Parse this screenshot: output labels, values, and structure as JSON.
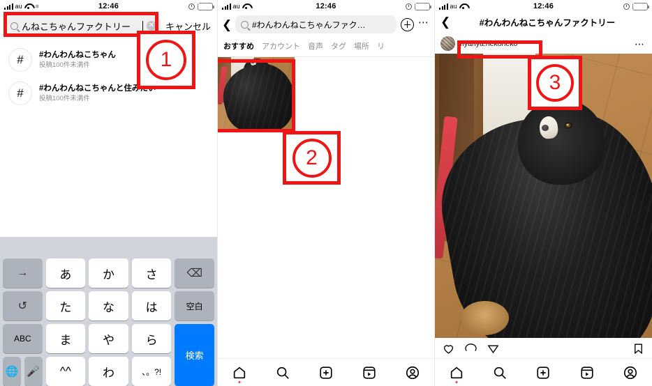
{
  "status_bar": {
    "carrier": "au",
    "time": "12:46",
    "signal_icon": "signal-bars-icon",
    "wifi_icon": "wifi-icon",
    "weather_icon": "snowflake-icon",
    "alarm_icon": "alarm-clock-icon",
    "battery_icon": "battery-charging-icon",
    "battery_color": "#3ad24a"
  },
  "panel1": {
    "search": {
      "value": "んねこちゃんファクトリー",
      "icon": "search-icon",
      "clear_icon": "clear-circle-icon",
      "cancel_label": "キャンセル"
    },
    "results": [
      {
        "icon": "hashtag-icon",
        "title": "#わんわんねこちゃん",
        "subtitle": "投稿100件未満件"
      },
      {
        "icon": "hashtag-icon",
        "title": "#わんわんねこちゃんと住みたい",
        "subtitle": "投稿100件未満件"
      }
    ],
    "keyboard": {
      "rows": [
        [
          {
            "label": "→",
            "type": "gray",
            "name": "key-next"
          },
          {
            "label": "あ",
            "type": "white",
            "name": "key-a"
          },
          {
            "label": "か",
            "type": "white",
            "name": "key-ka"
          },
          {
            "label": "さ",
            "type": "white",
            "name": "key-sa"
          },
          {
            "label": "⌫",
            "type": "gray",
            "name": "key-backspace"
          }
        ],
        [
          {
            "label": "↺",
            "type": "gray",
            "name": "key-undo"
          },
          {
            "label": "た",
            "type": "white",
            "name": "key-ta"
          },
          {
            "label": "な",
            "type": "white",
            "name": "key-na"
          },
          {
            "label": "は",
            "type": "white",
            "name": "key-ha"
          },
          {
            "label": "空白",
            "type": "gray-small",
            "name": "key-space"
          }
        ],
        [
          {
            "label": "ABC",
            "type": "gray-small",
            "name": "key-abc"
          },
          {
            "label": "ま",
            "type": "white",
            "name": "key-ma"
          },
          {
            "label": "や",
            "type": "white",
            "name": "key-ya"
          },
          {
            "label": "ら",
            "type": "white",
            "name": "key-ra"
          },
          {
            "label": "検索",
            "type": "blue",
            "name": "key-search"
          }
        ],
        [
          {
            "label": "",
            "type": "pair",
            "name": "key-globe-mic"
          },
          {
            "label": "^^",
            "type": "white",
            "name": "key-emoticon"
          },
          {
            "label": "わ",
            "type": "white",
            "name": "key-wa"
          },
          {
            "label": "、。?!",
            "type": "white-small",
            "name": "key-punct"
          }
        ]
      ],
      "globe_icon": "globe-icon",
      "mic_icon": "microphone-icon",
      "accent_color": "#007aff"
    }
  },
  "panel2": {
    "back_icon": "chevron-left-icon",
    "search": {
      "value": "#わんわんねこちゃんファク…",
      "icon": "search-icon"
    },
    "add_icon": "plus-circle-icon",
    "more_icon": "ellipsis-icon",
    "tabs": [
      {
        "label": "おすすめ",
        "active": true
      },
      {
        "label": "アカウント",
        "active": false
      },
      {
        "label": "音声",
        "active": false
      },
      {
        "label": "タグ",
        "active": false
      },
      {
        "label": "場所",
        "active": false
      }
    ],
    "thumbnail_alt": "black-dog-on-wooden-floor",
    "bottom_nav": [
      {
        "icon": "home-icon",
        "active": true,
        "dot": true
      },
      {
        "icon": "search-icon",
        "active": false,
        "dot": false
      },
      {
        "icon": "create-icon",
        "active": false,
        "dot": false
      },
      {
        "icon": "reels-icon",
        "active": false,
        "dot": false
      },
      {
        "icon": "profile-icon",
        "active": false,
        "dot": false
      }
    ]
  },
  "panel3": {
    "back_icon": "chevron-left-icon",
    "title": "#わんわんねこちゃんファクトリー",
    "post": {
      "avatar_icon": "user-avatar",
      "username": "nyanya.nekoneko",
      "more_icon": "ellipsis-icon",
      "photo_alt": "black-and-white-dog-lying-on-wooden-floor"
    },
    "actions": [
      {
        "icon": "heart-icon",
        "name": "like-button"
      },
      {
        "icon": "comment-icon",
        "name": "comment-button"
      },
      {
        "icon": "share-icon",
        "name": "share-button"
      },
      {
        "icon": "bookmark-icon",
        "name": "save-button"
      }
    ],
    "bottom_nav": [
      {
        "icon": "home-icon",
        "active": true,
        "dot": true
      },
      {
        "icon": "search-icon",
        "active": false,
        "dot": false
      },
      {
        "icon": "create-icon",
        "active": false,
        "dot": false
      },
      {
        "icon": "reels-icon",
        "active": false,
        "dot": false
      },
      {
        "icon": "profile-icon",
        "active": false,
        "dot": false
      }
    ]
  },
  "annotations": {
    "color": "#f01515",
    "markers": [
      {
        "number": "①",
        "digit": "1",
        "target": "search-input-panel1"
      },
      {
        "number": "②",
        "digit": "2",
        "target": "thumbnail-panel2"
      },
      {
        "number": "③",
        "digit": "3",
        "target": "username-panel3"
      }
    ]
  }
}
